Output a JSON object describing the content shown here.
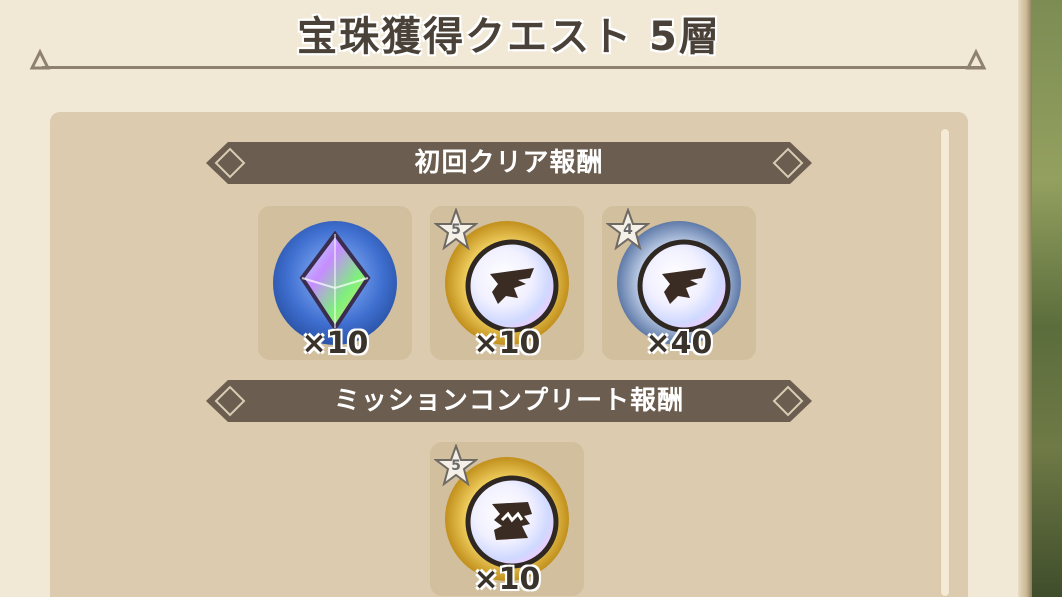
{
  "title": "宝珠獲得クエスト 5層",
  "sections": [
    {
      "label": "初回クリア報酬",
      "rewards": [
        {
          "item": "rainbow-crystal",
          "qty": "×10",
          "star": null,
          "color": "#3f6fd0"
        },
        {
          "item": "gold-orb-wing-emblem",
          "qty": "×10",
          "star": "5",
          "color": "#d8a92b"
        },
        {
          "item": "silver-orb-wing-emblem",
          "qty": "×40",
          "star": "4",
          "color": "#6d88b8"
        }
      ]
    },
    {
      "label": "ミッションコンプリート報酬",
      "rewards": [
        {
          "item": "gold-orb-monster-emblem",
          "qty": "×10",
          "star": "5",
          "color": "#d8a92b"
        }
      ]
    }
  ],
  "colors": {
    "banner": "#6b5d4f",
    "panel": "#dccbae",
    "background": "#f1e8d6"
  }
}
